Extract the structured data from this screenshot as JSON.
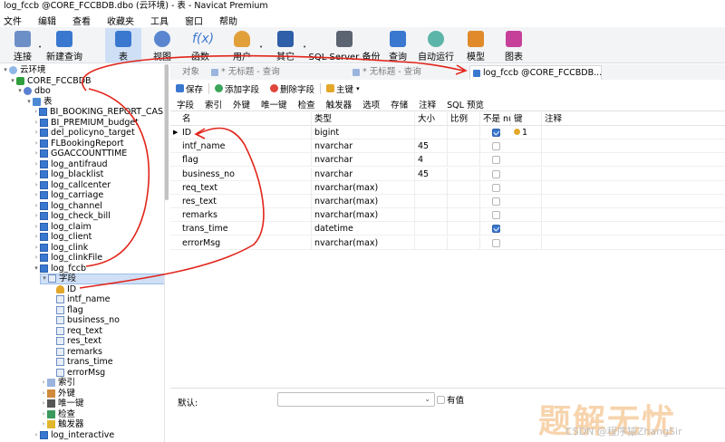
{
  "window": {
    "title": "log_fccb @CORE_FCCBDB.dbo (云环境) - 表 - Navicat Premium"
  },
  "menu": [
    "文件",
    "编辑",
    "查看",
    "收藏夹",
    "工具",
    "窗口",
    "帮助"
  ],
  "toolbar": {
    "connect": "连接",
    "new_query": "新建查询",
    "table": "表",
    "view": "视图",
    "function": "函数",
    "user": "用户",
    "other": "其它",
    "sql_server_backup": "SQL Server 备份",
    "query": "查询",
    "automation": "自动运行",
    "model": "模型",
    "chart": "图表"
  },
  "tree": {
    "root": "云环境",
    "database": "CORE_FCCBDB",
    "schema": "dbo",
    "tables_folder": "表",
    "tables": [
      "BI_BOOKING_REPORT_CAS",
      "BI_PREMIUM_budget",
      "del_policyno_target",
      "FLBookingReport",
      "GGACCOUNTTIME",
      "log_antifraud",
      "log_blacklist",
      "log_callcenter",
      "log_carriage",
      "log_channel",
      "log_check_bill",
      "log_claim",
      "log_client",
      "log_clink",
      "log_clinkFile",
      "log_fccb"
    ],
    "fields_folder": "字段",
    "fields": [
      "ID",
      "intf_name",
      "flag",
      "business_no",
      "req_text",
      "res_text",
      "remarks",
      "trans_time",
      "errorMsg"
    ],
    "other_folders": [
      "索引",
      "外键",
      "唯一键",
      "检查",
      "触发器"
    ],
    "next_table": "log_interactive"
  },
  "tabs": [
    {
      "label": "对象",
      "active": false
    },
    {
      "label": "* 无标题 - 查询",
      "active": false
    },
    {
      "label": "* 无标题 - 查询",
      "active": false
    },
    {
      "label": "log_fccb @CORE_FCCBDB...",
      "active": true
    }
  ],
  "editor_toolbar": {
    "save": "保存",
    "add_field": "添加字段",
    "delete_field": "删除字段",
    "primary_key": "主键"
  },
  "subtabs": [
    "字段",
    "索引",
    "外键",
    "唯一键",
    "检查",
    "触发器",
    "选项",
    "存储",
    "注释",
    "SQL 预览"
  ],
  "grid": {
    "headers": {
      "name": "名",
      "type": "类型",
      "size": "大小",
      "scale": "比例",
      "not_null": "不是 null",
      "key": "键",
      "comment": "注释"
    },
    "rows": [
      {
        "name": "ID",
        "type": "bigint",
        "size": "",
        "not_null": true,
        "key": "1",
        "current": true
      },
      {
        "name": "intf_name",
        "type": "nvarchar",
        "size": "45",
        "not_null": false,
        "key": ""
      },
      {
        "name": "flag",
        "type": "nvarchar",
        "size": "4",
        "not_null": false,
        "key": ""
      },
      {
        "name": "business_no",
        "type": "nvarchar",
        "size": "45",
        "not_null": false,
        "key": ""
      },
      {
        "name": "req_text",
        "type": "nvarchar(max)",
        "size": "",
        "not_null": false,
        "key": ""
      },
      {
        "name": "res_text",
        "type": "nvarchar(max)",
        "size": "",
        "not_null": false,
        "key": ""
      },
      {
        "name": "remarks",
        "type": "nvarchar(max)",
        "size": "",
        "not_null": false,
        "key": ""
      },
      {
        "name": "trans_time",
        "type": "datetime",
        "size": "",
        "not_null": true,
        "key": ""
      },
      {
        "name": "errorMsg",
        "type": "nvarchar(max)",
        "size": "",
        "not_null": false,
        "key": ""
      }
    ]
  },
  "props": {
    "default_label": "默认:",
    "has_value_label": "有值"
  },
  "watermark": {
    "main": "题解无忧",
    "sub": "CSDN @程序猿ZhangSir"
  },
  "colors": {
    "accent": "#3a78d0",
    "annotation": "#e1251b",
    "selection": "#cfe0f6"
  }
}
